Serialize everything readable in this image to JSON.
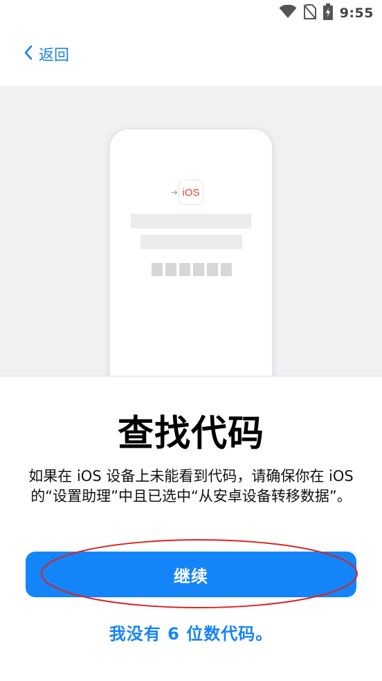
{
  "status_bar": {
    "time": "9:55",
    "icons": [
      "wifi-icon",
      "no-sim-icon",
      "battery-charging-icon"
    ]
  },
  "header": {
    "back_label": "返回",
    "back_icon": "chevron-left-icon"
  },
  "illustration": {
    "ios_badge_text": "iOS",
    "code_box_count": 6
  },
  "sheet": {
    "title": "查找代码",
    "description": "如果在 iOS 设备上未能看到代码，请确保你在 iOS 的“设置助理”中且已选中“从安卓设备转移数据”。",
    "continue_label": "继续",
    "no_code_link": "我没有 6 位数代码。"
  },
  "colors": {
    "accent": "#1484f9",
    "annotation": "#e02020",
    "illustration_bg": "#f1f1f4"
  }
}
